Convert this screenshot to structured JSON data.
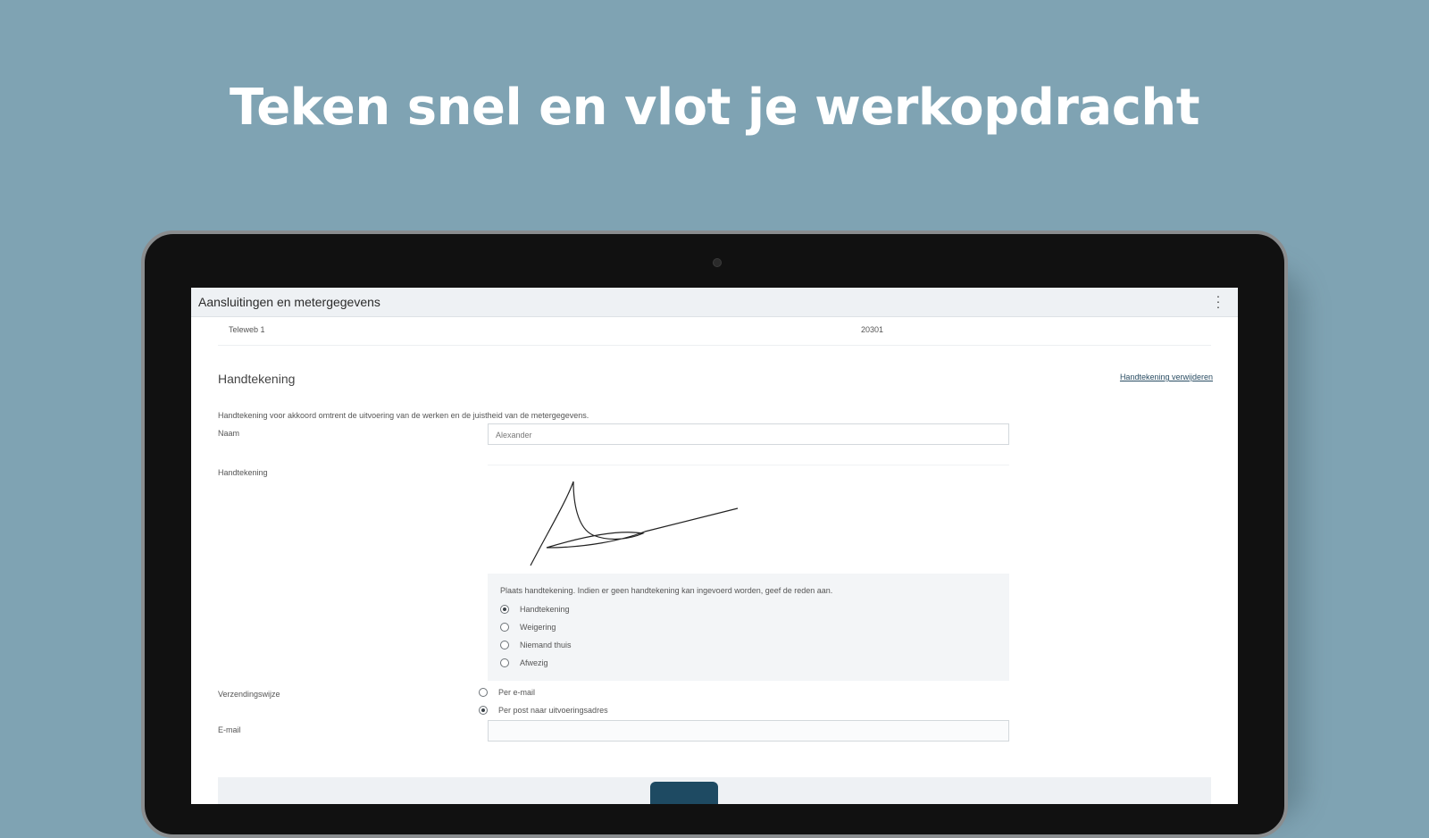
{
  "headline": "Teken snel en vlot je werkopdracht",
  "app": {
    "title": "Aansluitingen en metergegevens",
    "menu_icon": "kebab-menu-icon"
  },
  "subrow": {
    "left": "Teleweb 1",
    "right": "20301"
  },
  "signature_section": {
    "title": "Handtekening",
    "clear_link": "Handtekening verwijderen",
    "description": "Handtekening voor akkoord omtrent de uitvoering van de werken en de juistheid van de metergegevens.",
    "name_label": "Naam",
    "name_value": "Alexander",
    "signature_label": "Handtekening",
    "options_hint": "Plaats handtekening. Indien er geen handtekening kan ingevoerd worden, geef de reden aan.",
    "options": [
      {
        "label": "Handtekening",
        "checked": true
      },
      {
        "label": "Weigering",
        "checked": false
      },
      {
        "label": "Niemand thuis",
        "checked": false
      },
      {
        "label": "Afwezig",
        "checked": false
      }
    ],
    "delivery_label": "Verzendingswijze",
    "delivery_options": [
      {
        "label": "Per e-mail",
        "checked": false
      },
      {
        "label": "Per post naar uitvoeringsadres",
        "checked": true
      }
    ],
    "email_label": "E-mail",
    "email_value": ""
  },
  "colors": {
    "background": "#7fa3b3",
    "primary": "#1e4a62"
  }
}
